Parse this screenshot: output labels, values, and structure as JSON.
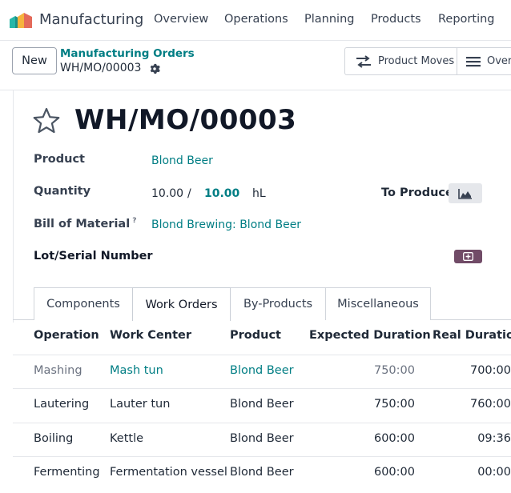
{
  "app": {
    "name": "Manufacturing"
  },
  "nav": {
    "overview": "Overview",
    "operations": "Operations",
    "planning": "Planning",
    "products": "Products",
    "reporting": "Reporting"
  },
  "control": {
    "new_label": "New",
    "breadcrumb_parent": "Manufacturing Orders",
    "breadcrumb_current": "WH/MO/00003",
    "product_moves_label": "Product Moves",
    "overview_label": "Overv"
  },
  "record": {
    "title": "WH/MO/00003",
    "product_label": "Product",
    "product_value": "Blond Beer",
    "quantity_label": "Quantity",
    "quantity_produced": "10.00",
    "quantity_sep": "/",
    "quantity_target": "10.00",
    "quantity_uom": "hL",
    "to_produce_label": "To Produce",
    "bom_label": "Bill of Material",
    "bom_help": "?",
    "bom_value": "Blond Brewing: Blond Beer",
    "lot_label": "Lot/Serial Number"
  },
  "tabs": [
    {
      "label": "Components",
      "active": false
    },
    {
      "label": "Work Orders",
      "active": true
    },
    {
      "label": "By-Products",
      "active": false
    },
    {
      "label": "Miscellaneous",
      "active": false
    }
  ],
  "table": {
    "headers": {
      "operation": "Operation",
      "work_center": "Work Center",
      "product": "Product",
      "expected": "Expected Duration",
      "real": "Real Duration"
    },
    "rows": [
      {
        "operation": "Mashing",
        "work_center": "Mash tun",
        "product": "Blond Beer",
        "expected": "750:00",
        "real": "700:00"
      },
      {
        "operation": "Lautering",
        "work_center": "Lauter tun",
        "product": "Blond Beer",
        "expected": "750:00",
        "real": "760:00"
      },
      {
        "operation": "Boiling",
        "work_center": "Kettle",
        "product": "Blond Beer",
        "expected": "600:00",
        "real": "09:36"
      },
      {
        "operation": "Fermenting",
        "work_center": "Fermentation vessel",
        "product": "Blond Beer",
        "expected": "600:00",
        "real": "00:00"
      }
    ]
  },
  "colors": {
    "accent": "#017e84",
    "brand": "#714b67"
  },
  "icons": {
    "logo": "manufacturing-logo-icon",
    "gear": "gear-icon",
    "star": "star-icon",
    "moves": "arrows-icon",
    "overview": "list-icon",
    "chart": "area-chart-icon",
    "plus": "plus-icon"
  }
}
